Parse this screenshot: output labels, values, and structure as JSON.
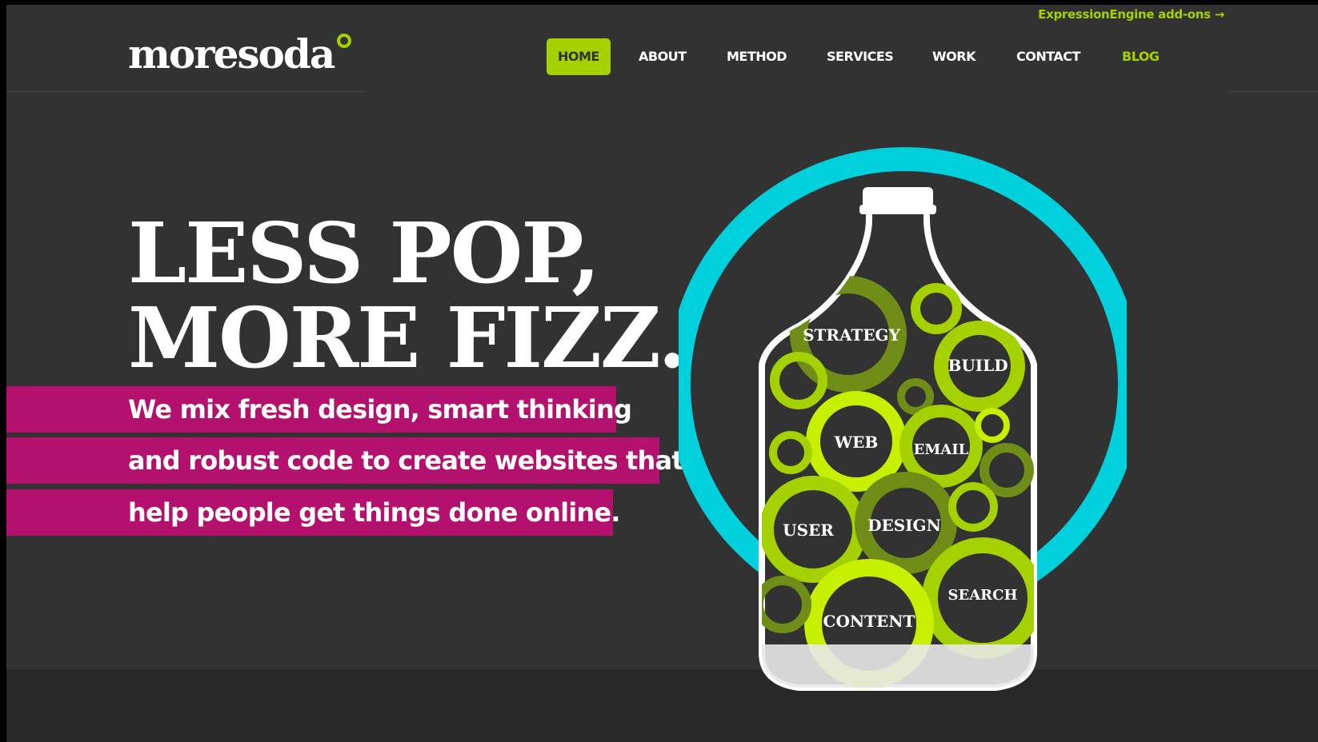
{
  "header": {
    "logo_text": "moresoda",
    "addon_link": "ExpressionEngine add-ons →"
  },
  "nav": {
    "items": [
      {
        "label": "HOME",
        "active": true
      },
      {
        "label": "ABOUT"
      },
      {
        "label": "METHOD"
      },
      {
        "label": "SERVICES"
      },
      {
        "label": "WORK"
      },
      {
        "label": "CONTACT"
      },
      {
        "label": "BLOG"
      }
    ]
  },
  "hero": {
    "headline_line1": "LESS POP,",
    "headline_line2": "MORE FIZZ.",
    "tagline_lines": [
      "We mix fresh design, smart thinking",
      "and robust code to create websites that",
      "help people get things done online."
    ]
  },
  "bottle": {
    "labels": [
      "STRATEGY",
      "BUILD",
      "WEB",
      "EMAIL",
      "USER",
      "DESIGN",
      "SEARCH",
      "CONTENT"
    ]
  },
  "colors": {
    "background": "#333233",
    "accent_green": "#a5d100",
    "accent_magenta": "#b3116d",
    "ring_cyan": "#00d0dc"
  }
}
